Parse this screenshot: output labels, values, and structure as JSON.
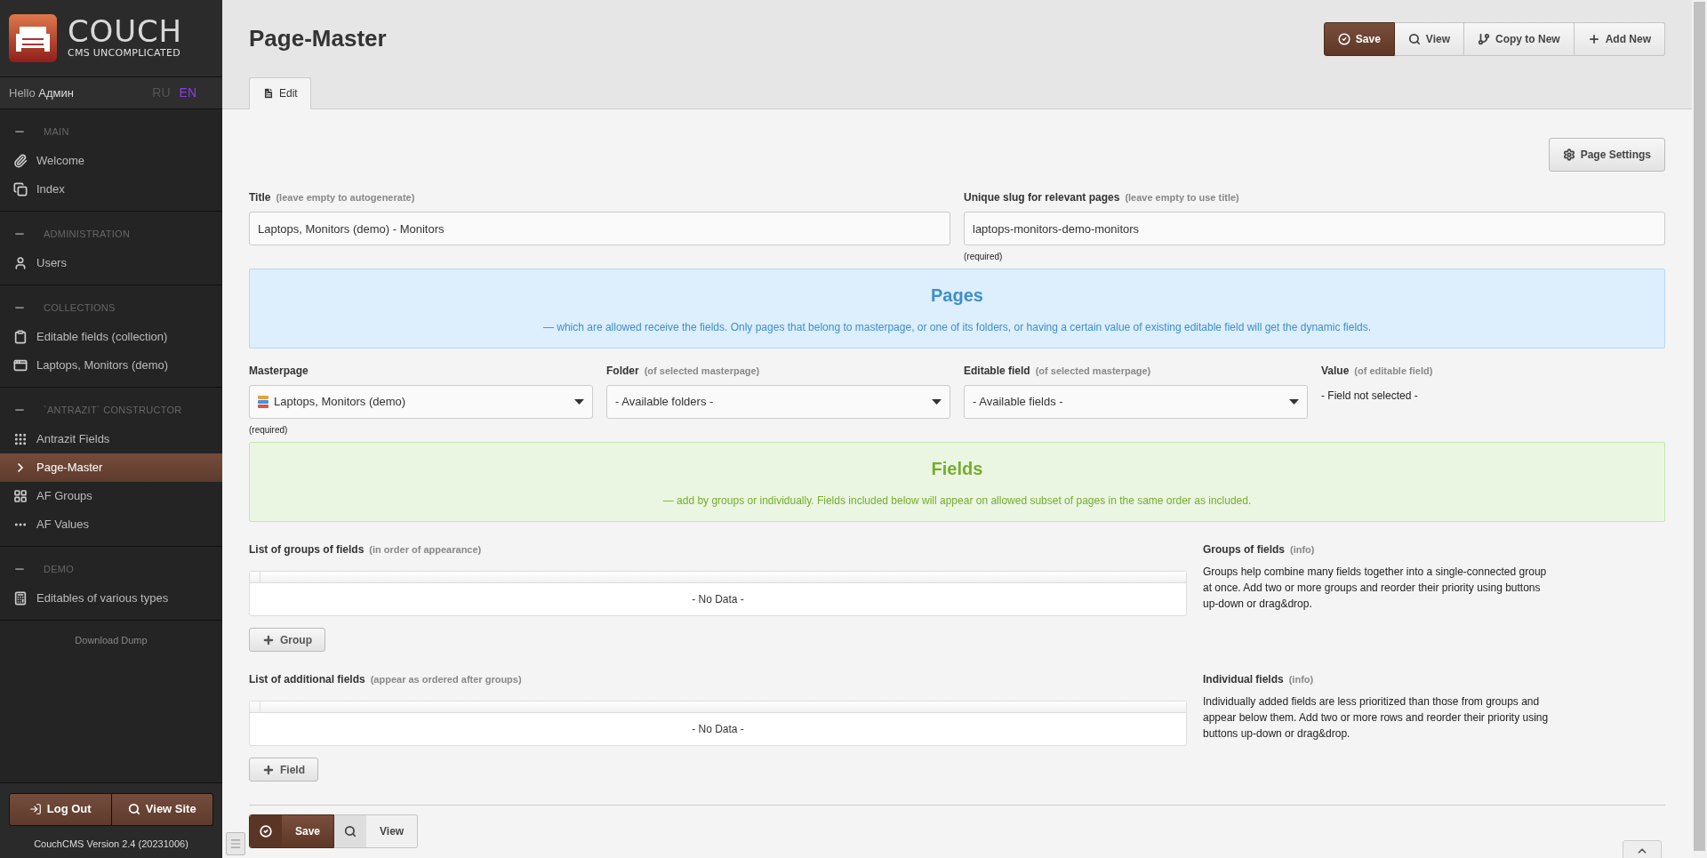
{
  "brand": {
    "name": "COUCH",
    "tagline": "CMS UNCOMPLICATED"
  },
  "greeting": {
    "text": "Hello",
    "user": "Админ"
  },
  "languages": [
    {
      "label": "RU",
      "selected": false
    },
    {
      "label": "EN",
      "selected": true
    }
  ],
  "sidebar": {
    "sections": [
      {
        "heading": "MAIN",
        "items": [
          {
            "label": "Welcome",
            "selected": false
          },
          {
            "label": "Index",
            "selected": false
          }
        ]
      },
      {
        "heading": "ADMINISTRATION",
        "items": [
          {
            "label": "Users",
            "selected": false
          }
        ]
      },
      {
        "heading": "COLLECTIONS",
        "items": [
          {
            "label": "Editable fields (collection)",
            "selected": false
          },
          {
            "label": "Laptops, Monitors (demo)",
            "selected": false
          }
        ]
      },
      {
        "heading": "`ANTRAZIT` CONSTRUCTOR",
        "items": [
          {
            "label": "Antrazit Fields",
            "selected": false
          },
          {
            "label": "Page-Master",
            "selected": true
          },
          {
            "label": "AF Groups",
            "selected": false
          },
          {
            "label": "AF Values",
            "selected": false
          }
        ]
      },
      {
        "heading": "DEMO",
        "items": [
          {
            "label": "Editables of various types",
            "selected": false
          }
        ]
      }
    ],
    "download_link": "Download Dump",
    "footer_buttons": [
      "Log Out",
      "View Site"
    ],
    "version": "CouchCMS Version 2.4 (20231006)"
  },
  "header": {
    "title": "Page-Master",
    "actions": [
      {
        "label": "Save",
        "kind": "primary"
      },
      {
        "label": "View",
        "kind": "default"
      },
      {
        "label": "Copy to New",
        "kind": "default"
      },
      {
        "label": "Add New",
        "kind": "default"
      }
    ]
  },
  "tabs": [
    {
      "label": "Edit",
      "selected": true
    }
  ],
  "page_settings_button": "Page Settings",
  "form": {
    "fields": [
      {
        "label": "Title",
        "hint": "(leave empty to autogenerate)",
        "value": "Laptops, Monitors (demo) - Monitors"
      },
      {
        "label": "Unique slug for relevant pages",
        "hint": "(leave empty to use title)",
        "value": "laptops-monitors-demo-monitors",
        "note": "(required)"
      }
    ],
    "pages_panel": {
      "heading": "Pages",
      "text": "— which are allowed receive the fields. Only pages that belong to masterpage, or one of its folders, or having a certain value of existing editable field will get the dynamic fields."
    },
    "filters": [
      {
        "kind": "select",
        "label": "Masterpage",
        "value": "Laptops, Monitors (demo)",
        "note": "(required)"
      },
      {
        "kind": "select",
        "label": "Folder",
        "hint": "(of selected masterpage)",
        "value": "- Available folders -"
      },
      {
        "kind": "select",
        "label": "Editable field",
        "hint": "(of selected masterpage)",
        "value": "- Available fields -"
      },
      {
        "kind": "text",
        "label": "Value",
        "hint": "(of editable field)",
        "value": "- Field not selected -"
      }
    ],
    "fields_panel": {
      "heading": "Fields",
      "text": "— add by groups or individually. Fields included below will appear on allowed subset of pages in the same order as included."
    },
    "lists": [
      {
        "label": "List of groups of fields",
        "hint": "(in order of appearance)",
        "empty_text": "- No Data -",
        "add_button": "Group",
        "info_title": "Groups of fields",
        "info_hint": "(info)",
        "info_text": "Groups help combine many fields together into a single-connected group at once. Add two or more groups and reorder their priority using buttons up-down or drag&drop."
      },
      {
        "label": "List of additional fields",
        "hint": "(appear as ordered after groups)",
        "empty_text": "- No Data -",
        "add_button": "Field",
        "info_title": "Individual fields",
        "info_hint": "(info)",
        "info_text": "Individually added fields are less prioritized than those from groups and appear below them. Add two or more rows and reorder their priority using buttons up-down or drag&drop."
      }
    ]
  },
  "bottom_actions": [
    {
      "label": "Save",
      "kind": "primary"
    },
    {
      "label": "View",
      "kind": "default"
    }
  ]
}
